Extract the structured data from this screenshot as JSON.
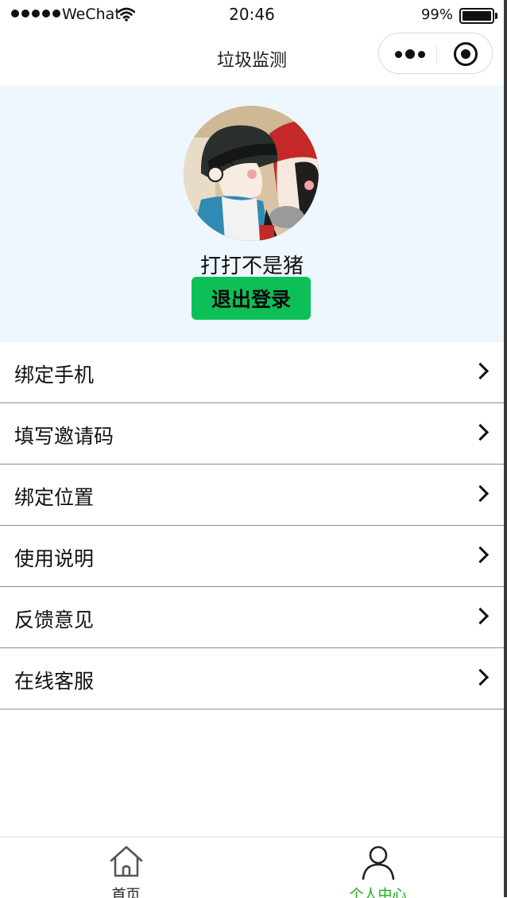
{
  "status_bar": {
    "carrier": "WeChat",
    "time": "20:46",
    "battery": "99%",
    "battery_level": 0.99
  },
  "nav": {
    "title": "垃圾监测"
  },
  "profile": {
    "username": "打打不是猪",
    "logout_label": "退出登录"
  },
  "menu": {
    "items": [
      {
        "label": "绑定手机"
      },
      {
        "label": "填写邀请码"
      },
      {
        "label": "绑定位置"
      },
      {
        "label": "使用说明"
      },
      {
        "label": "反馈意见"
      },
      {
        "label": "在线客服"
      }
    ]
  },
  "tabbar": {
    "items": [
      {
        "label": "首页",
        "icon": "home-icon",
        "active": false
      },
      {
        "label": "个人中心",
        "icon": "person-icon",
        "active": true
      }
    ],
    "active_color": "#1aad19"
  },
  "colors": {
    "profile_bg": "#eef6fe",
    "logout_button": "#0dbf57"
  }
}
